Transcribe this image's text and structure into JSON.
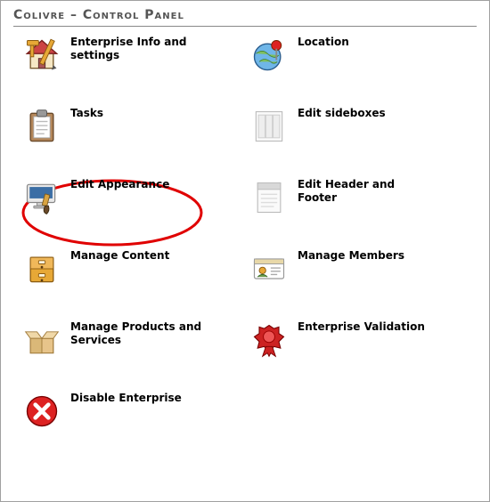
{
  "title": "Colivre – Control Panel",
  "items": [
    {
      "key": "enterprise-info",
      "label": "Enterprise Info and settings",
      "icon": "house-tools"
    },
    {
      "key": "location",
      "label": "Location",
      "icon": "globe-pin"
    },
    {
      "key": "tasks",
      "label": "Tasks",
      "icon": "clipboard"
    },
    {
      "key": "edit-sideboxes",
      "label": "Edit sideboxes",
      "icon": "columns-page"
    },
    {
      "key": "edit-appearance",
      "label": "Edit Appearance",
      "icon": "monitor-brush",
      "highlighted": true
    },
    {
      "key": "edit-header-footer",
      "label": "Edit Header and Footer",
      "icon": "header-page"
    },
    {
      "key": "manage-content",
      "label": "Manage Content",
      "icon": "drawer"
    },
    {
      "key": "manage-members",
      "label": "Manage Members",
      "icon": "member-card"
    },
    {
      "key": "manage-products",
      "label": "Manage Products and Services",
      "icon": "open-box"
    },
    {
      "key": "enterprise-validation",
      "label": "Enterprise Validation",
      "icon": "wax-seal"
    },
    {
      "key": "disable-enterprise",
      "label": "Disable Enterprise",
      "icon": "red-x"
    }
  ]
}
